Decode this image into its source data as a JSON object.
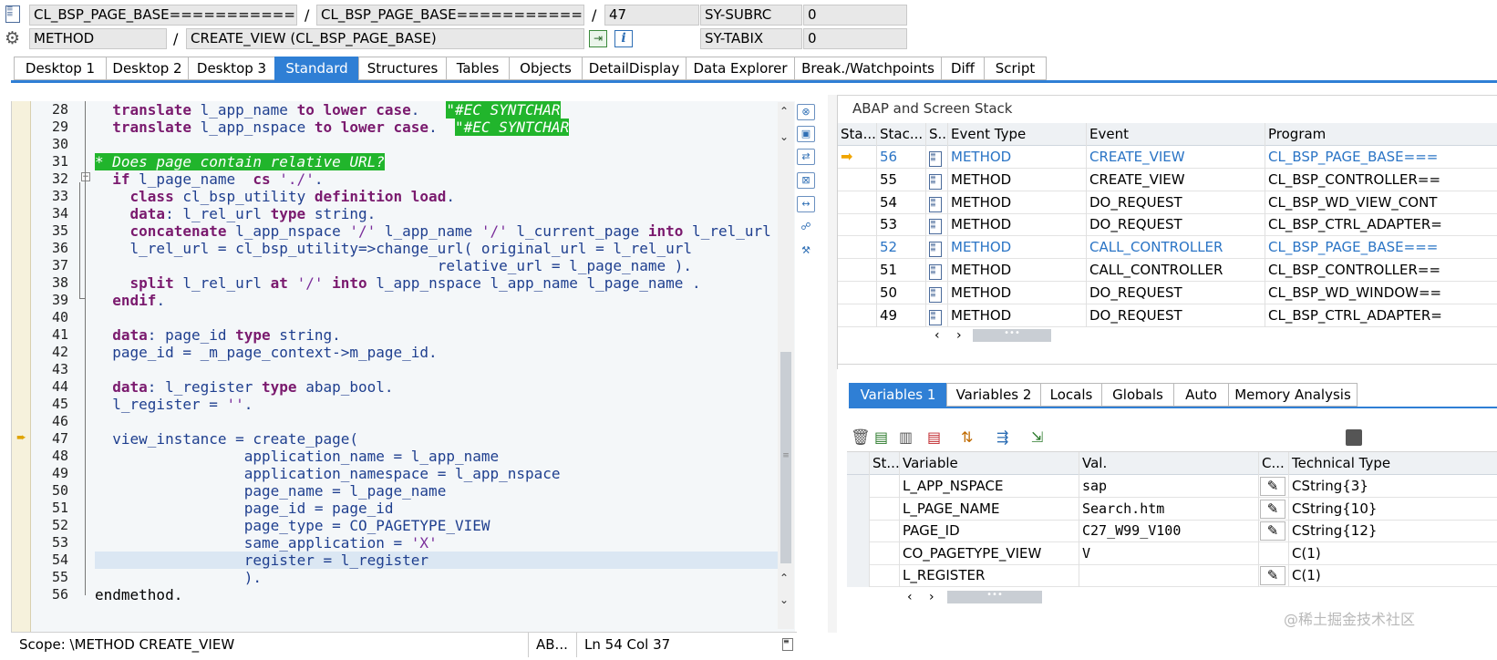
{
  "header": {
    "row1": {
      "program_main": "CL_BSP_PAGE_BASE=============...",
      "program_include": "CL_BSP_PAGE_BASE=============...",
      "line": "47",
      "sysvar_name": "SY-SUBRC",
      "sysvar_value": "0"
    },
    "row2": {
      "event_type": "METHOD",
      "event_name": "CREATE_VIEW (CL_BSP_PAGE_BASE)",
      "sysvar_name": "SY-TABIX",
      "sysvar_value": "0"
    },
    "separator": "/"
  },
  "tabs": [
    "Desktop 1",
    "Desktop 2",
    "Desktop 3",
    "Standard",
    "Structures",
    "Tables",
    "Objects",
    "DetailDisplay",
    "Data Explorer",
    "Break./Watchpoints",
    "Diff",
    "Script"
  ],
  "editor": {
    "line_numbers": [
      "28",
      "29",
      "30",
      "31",
      "32",
      "33",
      "34",
      "35",
      "36",
      "37",
      "38",
      "39",
      "40",
      "41",
      "42",
      "43",
      "44",
      "45",
      "46",
      "47",
      "48",
      "49",
      "50",
      "51",
      "52",
      "53",
      "54",
      "55",
      "56"
    ],
    "line28": {
      "a": "translate",
      "b": " l_app_name ",
      "c": "to lower case",
      "d": ".   ",
      "e": "\"#EC SYNTCHAR"
    },
    "line29": {
      "a": "translate",
      "b": " l_app_nspace ",
      "c": "to lower case",
      "d": ".  ",
      "e": "\"#EC SYNTCHAR"
    },
    "line31": "* Does page contain relative URL?",
    "line32": {
      "a": "if",
      "b": " l_page_name  ",
      "c": "cs",
      "d": " './'",
      "e": "."
    },
    "line33": {
      "a": "class",
      "b": " cl_bsp_utility ",
      "c": "definition load",
      "d": "."
    },
    "line34": {
      "a": "data",
      "b": ": l_rel_url ",
      "c": "type",
      "d": " string."
    },
    "line35": {
      "a": "concatenate",
      "b": " l_app_nspace ",
      "c": "'/'",
      "d": " l_app_name ",
      "e": "'/'",
      "f": " l_current_page ",
      "g": "into",
      "h": " l_rel_url"
    },
    "line36": "l_rel_url = cl_bsp_utility=>change_url( original_url = l_rel_url",
    "line37": "relative_url = l_page_name ).",
    "line38": {
      "a": "split",
      "b": " l_rel_url ",
      "c": "at",
      "d": " '/' ",
      "e": "into",
      "f": " l_app_nspace l_app_name l_page_name ."
    },
    "line39": {
      "a": "endif",
      "b": "."
    },
    "line41": {
      "a": "data",
      "b": ": page_id ",
      "c": "type",
      "d": " string."
    },
    "line42": "page_id = _m_page_context->m_page_id.",
    "line44": {
      "a": "data",
      "b": ": l_register ",
      "c": "type",
      "d": " abap_bool."
    },
    "line45": {
      "a": "l_register = ",
      "b": "''",
      "c": "."
    },
    "line47": "view_instance = create_page(",
    "line48": "application_name = l_app_name",
    "line49": "application_namespace = l_app_nspace",
    "line50": "page_name = l_page_name",
    "line51": "page_id = page_id",
    "line52": "page_type = CO_PAGETYPE_VIEW",
    "line53": {
      "a": "same_application = ",
      "b": "'X'"
    },
    "line54": "register = l_register",
    "line55": ").",
    "line56": {
      "a": "endmethod",
      "b": "."
    }
  },
  "statusbar": {
    "scope": "Scope: \\METHOD CREATE_VIEW",
    "lang": "AB...",
    "ln_label": "Ln",
    "ln": "54",
    "col_label": "Col",
    "col": "37"
  },
  "stack": {
    "title": "ABAP and Screen Stack",
    "columns": [
      "Sta...",
      "Stac...",
      "S...",
      "Event Type",
      "Event",
      "Program"
    ],
    "rows": [
      {
        "level": "56",
        "type": "METHOD",
        "event": "CREATE_VIEW",
        "program": "CL_BSP_PAGE_BASE===",
        "highlight": true,
        "current": true
      },
      {
        "level": "55",
        "type": "METHOD",
        "event": "CREATE_VIEW",
        "program": "CL_BSP_CONTROLLER==",
        "highlight": false,
        "current": false
      },
      {
        "level": "54",
        "type": "METHOD",
        "event": "DO_REQUEST",
        "program": "CL_BSP_WD_VIEW_CONT",
        "highlight": false,
        "current": false
      },
      {
        "level": "53",
        "type": "METHOD",
        "event": "DO_REQUEST",
        "program": "CL_BSP_CTRL_ADAPTER=",
        "highlight": false,
        "current": false
      },
      {
        "level": "52",
        "type": "METHOD",
        "event": "CALL_CONTROLLER",
        "program": "CL_BSP_PAGE_BASE===",
        "highlight": true,
        "current": false
      },
      {
        "level": "51",
        "type": "METHOD",
        "event": "CALL_CONTROLLER",
        "program": "CL_BSP_CONTROLLER==",
        "highlight": false,
        "current": false
      },
      {
        "level": "50",
        "type": "METHOD",
        "event": "DO_REQUEST",
        "program": "CL_BSP_WD_WINDOW==",
        "highlight": false,
        "current": false
      },
      {
        "level": "49",
        "type": "METHOD",
        "event": "DO_REQUEST",
        "program": "CL_BSP_CTRL_ADAPTER=",
        "highlight": false,
        "current": false
      }
    ]
  },
  "var_tabs": [
    "Variables 1",
    "Variables 2",
    "Locals",
    "Globals",
    "Auto",
    "Memory Analysis"
  ],
  "variables": {
    "columns": [
      "St...",
      "Variable",
      "Val.",
      "C...",
      "Technical Type"
    ],
    "rows": [
      {
        "name": "L_APP_NSPACE",
        "value": "sap",
        "type": "CString{3}",
        "editable": true
      },
      {
        "name": "L_PAGE_NAME",
        "value": "Search.htm",
        "type": "CString{10}",
        "editable": true
      },
      {
        "name": "PAGE_ID",
        "value": "C27_W99_V100",
        "type": "CString{12}",
        "editable": true
      },
      {
        "name": "CO_PAGETYPE_VIEW",
        "value": "V",
        "type": "C(1)",
        "editable": false
      },
      {
        "name": "L_REGISTER",
        "value": "",
        "type": "C(1)",
        "editable": true
      }
    ]
  },
  "watermark": "@稀土掘金技术社区",
  "colors": {
    "accent": "#2f7fd5",
    "comment_bg": "#21b52c",
    "keyword": "#7a1a6e",
    "link": "#2a74c5"
  }
}
